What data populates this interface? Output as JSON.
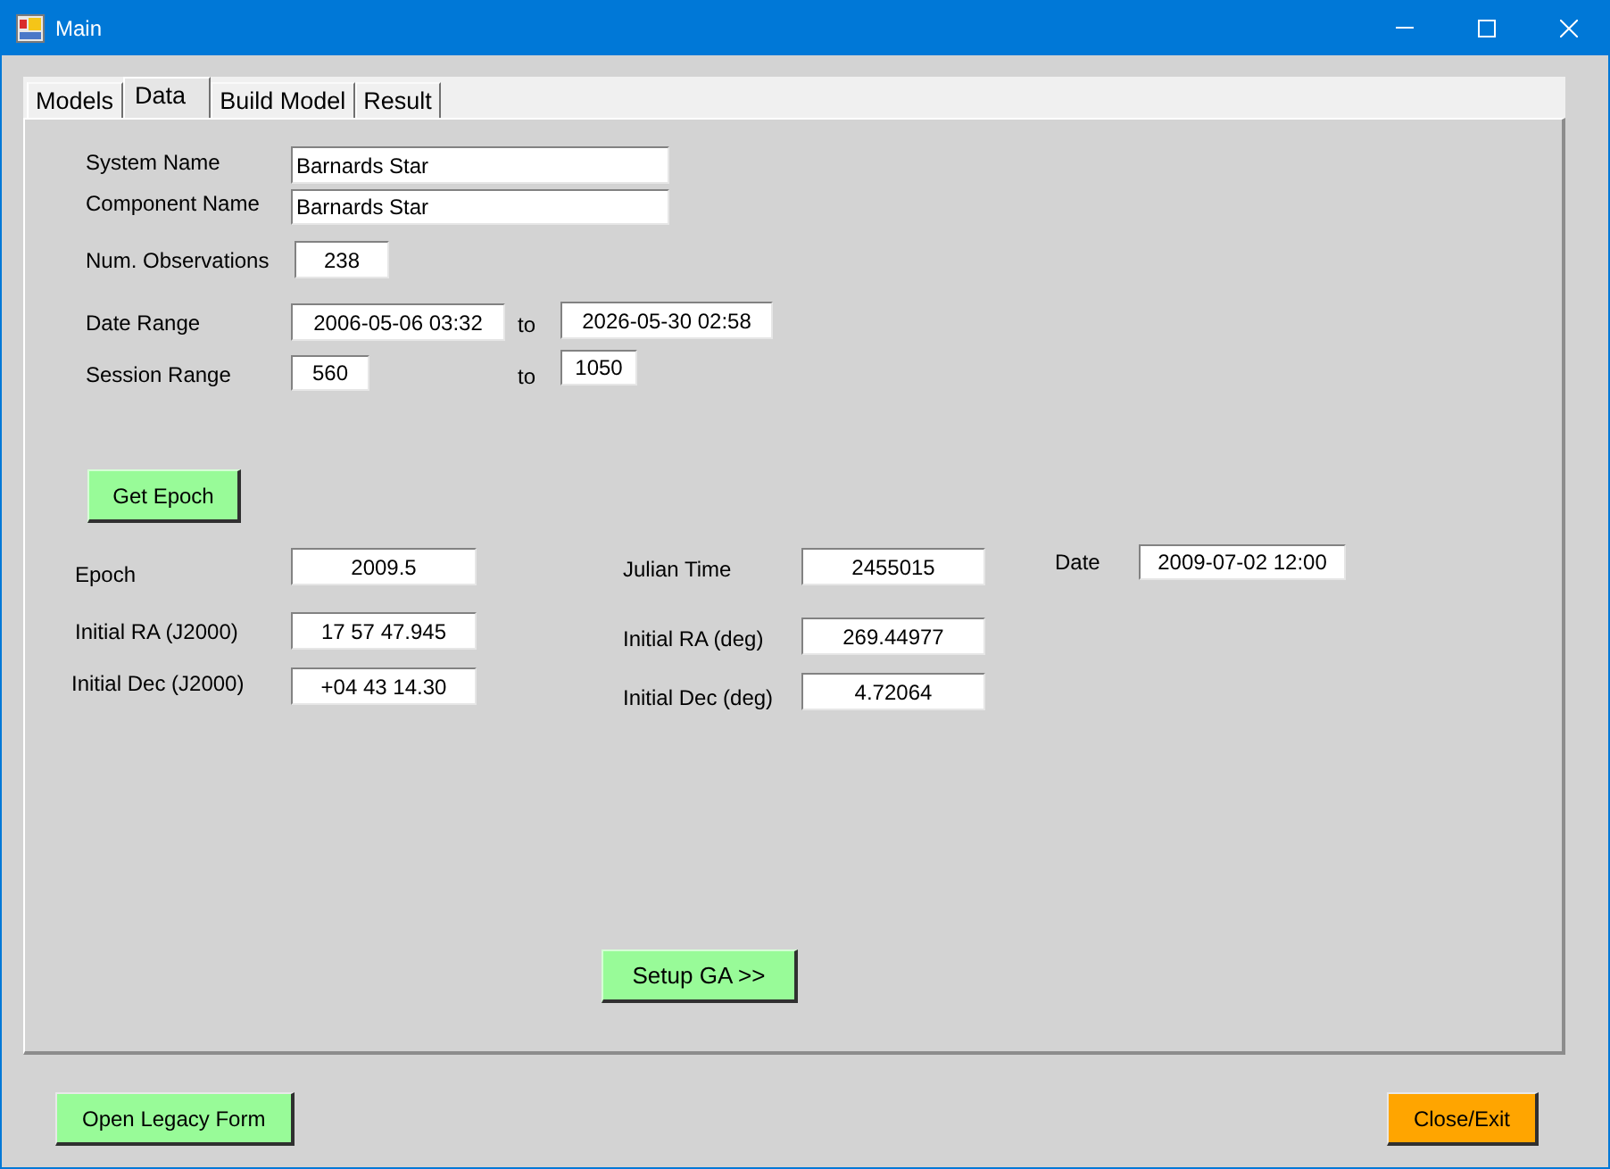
{
  "window": {
    "title": "Main"
  },
  "tabs": [
    {
      "label": "Models",
      "selected": false
    },
    {
      "label": "Data",
      "selected": true
    },
    {
      "label": "Build Model",
      "selected": false
    },
    {
      "label": "Result",
      "selected": false
    }
  ],
  "source": {
    "system_name": {
      "label": "System Name",
      "value": "Barnards Star"
    },
    "component_name": {
      "label": "Component Name",
      "value": "Barnards Star"
    },
    "num_observations": {
      "label": "Num. Observations",
      "value": "238"
    },
    "date_range": {
      "label": "Date Range",
      "from": "2006-05-06 03:32",
      "separator": "to",
      "to": "2026-05-30 02:58"
    },
    "session_range": {
      "label": "Session Range",
      "from": "560",
      "separator": "to",
      "to": "1050"
    }
  },
  "get_epoch_button": "Get Epoch",
  "epoch": {
    "epoch": {
      "label": "Epoch",
      "value": "2009.5"
    },
    "initial_ra_j2000": {
      "label": "Initial RA (J2000)",
      "value": "17 57 47.945"
    },
    "initial_dec_j2000": {
      "label": "Initial Dec (J2000)",
      "value": "+04 43 14.30"
    },
    "julian_time": {
      "label": "Julian Time",
      "value": "2455015"
    },
    "initial_ra_deg": {
      "label": "Initial RA (deg)",
      "value": "269.44977"
    },
    "initial_dec_deg": {
      "label": "Initial Dec (deg)",
      "value": "4.72064"
    },
    "date": {
      "label": "Date",
      "value": "2009-07-02 12:00"
    }
  },
  "setup_ga_button": "Setup GA >>",
  "footer_buttons": [
    {
      "label": "Open Legacy Form",
      "color": "#98fb98"
    },
    {
      "label": "Close/Exit",
      "color": "#ffa500"
    }
  ]
}
